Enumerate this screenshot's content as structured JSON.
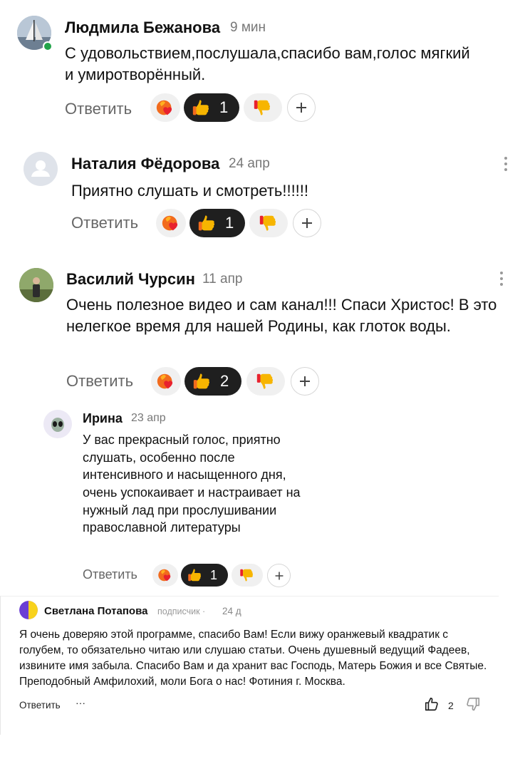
{
  "comments": [
    {
      "author": "Людмила Бежанова",
      "time": "9 мин",
      "text": "С удовольствием,послушала,спасибо вам,голос мягкий и умиротворённый.",
      "reply_label": "Ответить",
      "likes": "1"
    },
    {
      "author": "Наталия Фёдорова",
      "time": "24 апр",
      "text": "Приятно слушать и смотреть!!!!!!",
      "reply_label": "Ответить",
      "likes": "1"
    },
    {
      "author": "Василий Чурсин",
      "time": "11 апр",
      "text": "Очень полезное видео и сам канал!!! Спаси Христос! В это нелегкое время для нашей Родины, как глоток воды.",
      "reply_label": "Ответить",
      "likes": "2"
    },
    {
      "author": "Ирина",
      "time": "23 апр",
      "text": "У вас прекрасный голос, приятно слушать, особенно после интенсивного и насыщенного дня, очень успокаивает и настраивает на нужный лад при прослушивании православной литературы",
      "reply_label": "Ответить",
      "likes": "1"
    }
  ],
  "footer_comment": {
    "author": "Светлана Потапова",
    "badge": "подписчик ·",
    "time": "24 д",
    "text": "Я очень доверяю этой программе, спасибо Вам! Если вижу оранжевый квадратик с голубем, то обязательно читаю или слушаю статьи. Очень душевный ведущий Фадеев, извините имя забыла. Спасибо Вам и да хранит вас Господь, Матерь Божия и все Святые. Преподобный Амфилохий, моли Бога о нас! Фотиния г. Москва.",
    "reply_label": "Ответить",
    "more": "···",
    "likes": "2"
  },
  "icons": {
    "heart_reaction": "heart-fire-icon",
    "like_reaction": "thumbs-up-icon",
    "dislike_reaction": "thumbs-down-icon",
    "add_reaction": "plus-icon",
    "menu": "kebab-icon"
  },
  "colors": {
    "like_pill": "#1f1f1f",
    "reaction_pill": "#f0f0f0",
    "online": "#22a34a",
    "emoji_yellow": "#f7b500",
    "emoji_orange": "#f26b1d",
    "heart_red": "#e8222e"
  }
}
